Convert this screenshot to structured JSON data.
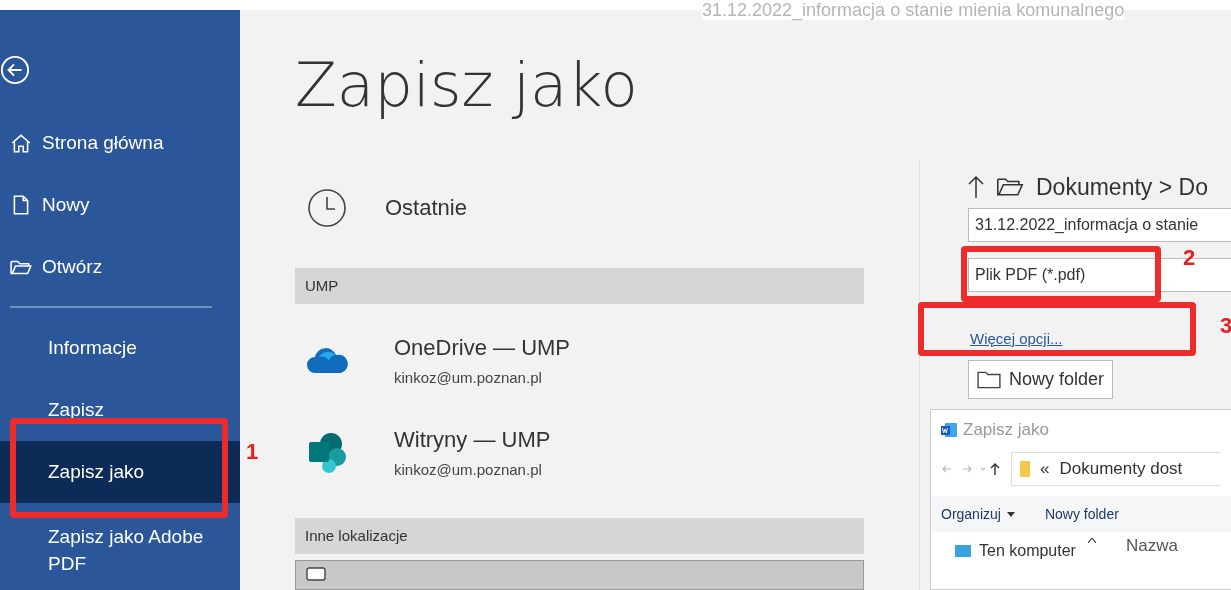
{
  "window": {
    "title": "31.12.2022_informacja o stanie mienia komunalnego"
  },
  "sidebar": {
    "items": [
      {
        "kind": "home",
        "label": "Strona główna",
        "selected": false
      },
      {
        "kind": "document",
        "label": "Nowy",
        "selected": false
      },
      {
        "kind": "folder",
        "label": "Otwórz",
        "selected": false
      },
      {
        "kind": "page",
        "label": "Informacje",
        "selected": false
      },
      {
        "kind": "page",
        "label": "Zapisz",
        "selected": false
      },
      {
        "kind": "page",
        "label": "Zapisz jako",
        "selected": true
      },
      {
        "kind": "page",
        "label": "Zapisz jako Adobe PDF",
        "selected": false
      }
    ]
  },
  "page_title": "Zapisz jako",
  "recent": {
    "label": "Ostatnie"
  },
  "groups": [
    {
      "heading": "UMP",
      "places": [
        {
          "kind": "cloud",
          "name": "OneDrive — UMP",
          "account": "kinkoz@um.poznan.pl",
          "selected": false
        },
        {
          "kind": "sharepoint",
          "name": "Witryny — UMP",
          "account": "kinkoz@um.poznan.pl",
          "selected": false
        }
      ]
    },
    {
      "heading": "Inne lokalizacje",
      "places": [
        {
          "kind": "computer",
          "selected": true
        }
      ]
    }
  ],
  "save_panel": {
    "breadcrumb": "Dokumenty > Do",
    "filename": "31.12.2022_informacja o stanie",
    "file_type": "Plik PDF (*.pdf)",
    "more_options": "Więcej opcji...",
    "new_folder": "Nowy folder"
  },
  "dialog": {
    "title": "Zapisz jako",
    "address": "Dokumenty dost",
    "address_prefix": "«",
    "toolbar": [
      "Organizuj",
      "Nowy folder"
    ],
    "nav_item": "Ten komputer",
    "column": "Nazwa"
  },
  "annotations": [
    "1",
    "2",
    "3"
  ]
}
